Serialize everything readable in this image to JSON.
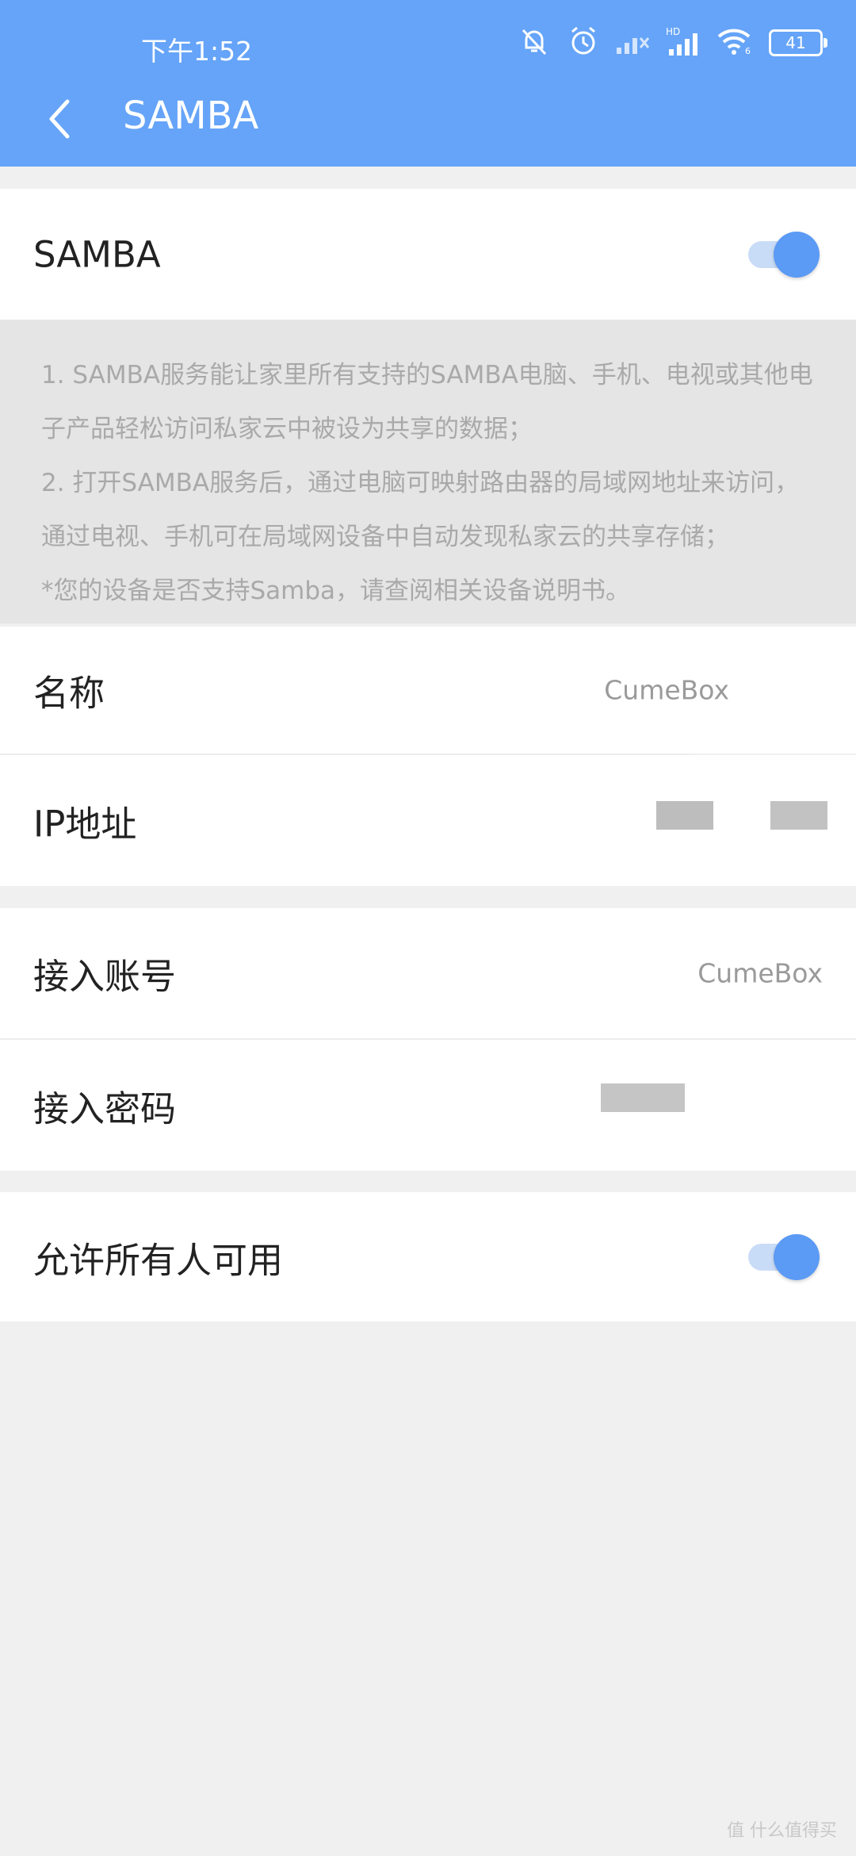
{
  "status_bar": {
    "time": "下午1:52",
    "battery": "41",
    "icons": [
      "mute-icon",
      "alarm-icon",
      "signal-icon",
      "signal-hd-icon",
      "wifi-icon",
      "battery-icon"
    ]
  },
  "header": {
    "title": "SAMBA",
    "back_icon": "chevron-left-icon",
    "background_color": "#65a4f8"
  },
  "samba_row": {
    "label": "SAMBA",
    "enabled": true
  },
  "info": {
    "lines": [
      "1. SAMBA服务能让家里所有支持的SAMBA电脑、手机、电视或其他电子产品轻松访问私家云中被设为共享的数据；",
      " 2. 打开SAMBA服务后，通过电脑可映射路由器的局域网地址来访问，通过电视、手机可在局域网设备中自动发现私家云的共享存储；",
      " *您的设备是否支持Samba，请查阅相关设备说明书。"
    ]
  },
  "settings": {
    "name": {
      "label": "名称",
      "value": "CumeBox"
    },
    "ip": {
      "label": "IP地址",
      "value": ""
    },
    "account": {
      "label": "接入账号",
      "value": "CumeBox"
    },
    "password": {
      "label": "接入密码",
      "value": ""
    },
    "allow_all": {
      "label": "允许所有人可用",
      "enabled": true
    }
  },
  "accent_color": "#5b9af5",
  "watermark": "值 什么值得买"
}
